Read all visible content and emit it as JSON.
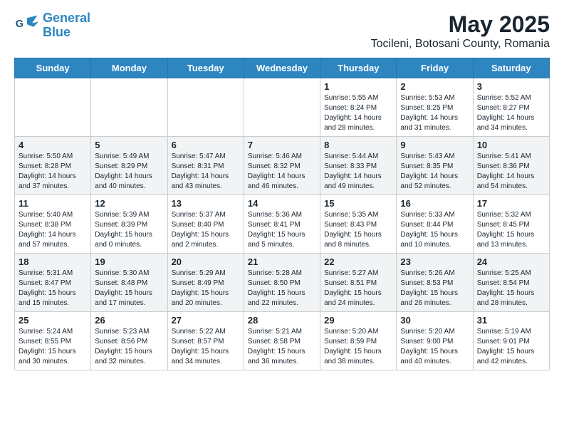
{
  "app": {
    "logo_line1": "General",
    "logo_line2": "Blue"
  },
  "header": {
    "title": "May 2025",
    "subtitle": "Tocileni, Botosani County, Romania"
  },
  "weekdays": [
    "Sunday",
    "Monday",
    "Tuesday",
    "Wednesday",
    "Thursday",
    "Friday",
    "Saturday"
  ],
  "weeks": [
    [
      {
        "day": "",
        "info": ""
      },
      {
        "day": "",
        "info": ""
      },
      {
        "day": "",
        "info": ""
      },
      {
        "day": "",
        "info": ""
      },
      {
        "day": "1",
        "info": "Sunrise: 5:55 AM\nSunset: 8:24 PM\nDaylight: 14 hours\nand 28 minutes."
      },
      {
        "day": "2",
        "info": "Sunrise: 5:53 AM\nSunset: 8:25 PM\nDaylight: 14 hours\nand 31 minutes."
      },
      {
        "day": "3",
        "info": "Sunrise: 5:52 AM\nSunset: 8:27 PM\nDaylight: 14 hours\nand 34 minutes."
      }
    ],
    [
      {
        "day": "4",
        "info": "Sunrise: 5:50 AM\nSunset: 8:28 PM\nDaylight: 14 hours\nand 37 minutes."
      },
      {
        "day": "5",
        "info": "Sunrise: 5:49 AM\nSunset: 8:29 PM\nDaylight: 14 hours\nand 40 minutes."
      },
      {
        "day": "6",
        "info": "Sunrise: 5:47 AM\nSunset: 8:31 PM\nDaylight: 14 hours\nand 43 minutes."
      },
      {
        "day": "7",
        "info": "Sunrise: 5:46 AM\nSunset: 8:32 PM\nDaylight: 14 hours\nand 46 minutes."
      },
      {
        "day": "8",
        "info": "Sunrise: 5:44 AM\nSunset: 8:33 PM\nDaylight: 14 hours\nand 49 minutes."
      },
      {
        "day": "9",
        "info": "Sunrise: 5:43 AM\nSunset: 8:35 PM\nDaylight: 14 hours\nand 52 minutes."
      },
      {
        "day": "10",
        "info": "Sunrise: 5:41 AM\nSunset: 8:36 PM\nDaylight: 14 hours\nand 54 minutes."
      }
    ],
    [
      {
        "day": "11",
        "info": "Sunrise: 5:40 AM\nSunset: 8:38 PM\nDaylight: 14 hours\nand 57 minutes."
      },
      {
        "day": "12",
        "info": "Sunrise: 5:39 AM\nSunset: 8:39 PM\nDaylight: 15 hours\nand 0 minutes."
      },
      {
        "day": "13",
        "info": "Sunrise: 5:37 AM\nSunset: 8:40 PM\nDaylight: 15 hours\nand 2 minutes."
      },
      {
        "day": "14",
        "info": "Sunrise: 5:36 AM\nSunset: 8:41 PM\nDaylight: 15 hours\nand 5 minutes."
      },
      {
        "day": "15",
        "info": "Sunrise: 5:35 AM\nSunset: 8:43 PM\nDaylight: 15 hours\nand 8 minutes."
      },
      {
        "day": "16",
        "info": "Sunrise: 5:33 AM\nSunset: 8:44 PM\nDaylight: 15 hours\nand 10 minutes."
      },
      {
        "day": "17",
        "info": "Sunrise: 5:32 AM\nSunset: 8:45 PM\nDaylight: 15 hours\nand 13 minutes."
      }
    ],
    [
      {
        "day": "18",
        "info": "Sunrise: 5:31 AM\nSunset: 8:47 PM\nDaylight: 15 hours\nand 15 minutes."
      },
      {
        "day": "19",
        "info": "Sunrise: 5:30 AM\nSunset: 8:48 PM\nDaylight: 15 hours\nand 17 minutes."
      },
      {
        "day": "20",
        "info": "Sunrise: 5:29 AM\nSunset: 8:49 PM\nDaylight: 15 hours\nand 20 minutes."
      },
      {
        "day": "21",
        "info": "Sunrise: 5:28 AM\nSunset: 8:50 PM\nDaylight: 15 hours\nand 22 minutes."
      },
      {
        "day": "22",
        "info": "Sunrise: 5:27 AM\nSunset: 8:51 PM\nDaylight: 15 hours\nand 24 minutes."
      },
      {
        "day": "23",
        "info": "Sunrise: 5:26 AM\nSunset: 8:53 PM\nDaylight: 15 hours\nand 26 minutes."
      },
      {
        "day": "24",
        "info": "Sunrise: 5:25 AM\nSunset: 8:54 PM\nDaylight: 15 hours\nand 28 minutes."
      }
    ],
    [
      {
        "day": "25",
        "info": "Sunrise: 5:24 AM\nSunset: 8:55 PM\nDaylight: 15 hours\nand 30 minutes."
      },
      {
        "day": "26",
        "info": "Sunrise: 5:23 AM\nSunset: 8:56 PM\nDaylight: 15 hours\nand 32 minutes."
      },
      {
        "day": "27",
        "info": "Sunrise: 5:22 AM\nSunset: 8:57 PM\nDaylight: 15 hours\nand 34 minutes."
      },
      {
        "day": "28",
        "info": "Sunrise: 5:21 AM\nSunset: 8:58 PM\nDaylight: 15 hours\nand 36 minutes."
      },
      {
        "day": "29",
        "info": "Sunrise: 5:20 AM\nSunset: 8:59 PM\nDaylight: 15 hours\nand 38 minutes."
      },
      {
        "day": "30",
        "info": "Sunrise: 5:20 AM\nSunset: 9:00 PM\nDaylight: 15 hours\nand 40 minutes."
      },
      {
        "day": "31",
        "info": "Sunrise: 5:19 AM\nSunset: 9:01 PM\nDaylight: 15 hours\nand 42 minutes."
      }
    ]
  ]
}
